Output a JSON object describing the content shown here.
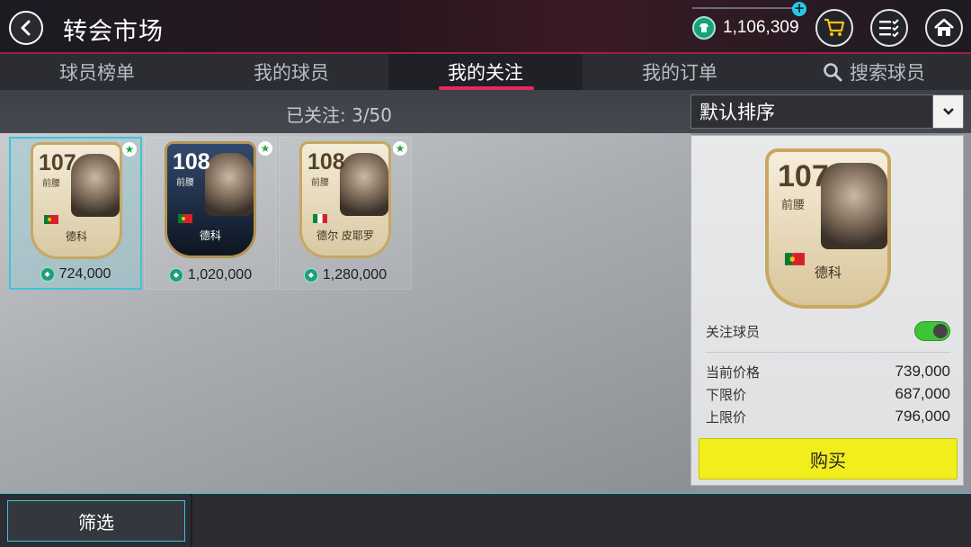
{
  "header": {
    "title": "转会市场",
    "coin_balance": "1,106,309",
    "icons": [
      "back-icon",
      "coin-icon",
      "plus-icon",
      "cart-icon",
      "menu-icon",
      "home-icon"
    ]
  },
  "tabs": [
    {
      "label": "球员榜单",
      "active": false
    },
    {
      "label": "我的球员",
      "active": false
    },
    {
      "label": "我的关注",
      "active": true
    },
    {
      "label": "我的订单",
      "active": false
    },
    {
      "label": "搜索球员",
      "active": false,
      "icon": "search-icon"
    }
  ],
  "subbar": {
    "follow_count": "已关注:  3/50",
    "sort_label": "默认排序"
  },
  "cards": [
    {
      "rating": "107",
      "position": "前腰",
      "name": "德科",
      "price": "724,000",
      "selected": true,
      "style": "icon-white"
    },
    {
      "rating": "108",
      "position": "前腰",
      "name": "德科",
      "price": "1,020,000",
      "selected": false,
      "style": "dark"
    },
    {
      "rating": "108",
      "position": "前腰",
      "name": "德尔 皮耶罗",
      "price": "1,280,000",
      "selected": false,
      "style": "icon-white"
    }
  ],
  "detail": {
    "rating": "107",
    "position": "前腰",
    "name": "德科",
    "watch_label": "关注球员",
    "watch_on": true,
    "current_price_label": "当前价格",
    "current_price": "739,000",
    "lower_limit_label": "下限价",
    "lower_limit": "687,000",
    "upper_limit_label": "上限价",
    "upper_limit": "796,000",
    "buy_label": "购买"
  },
  "bottom": {
    "filter_label": "筛选"
  },
  "colors": {
    "accent_tab": "#e62a5c",
    "selection": "#3fc4d6",
    "buy_button": "#f2ee1c",
    "toggle_on": "#3ec437",
    "coin": "#1f9e7a"
  }
}
